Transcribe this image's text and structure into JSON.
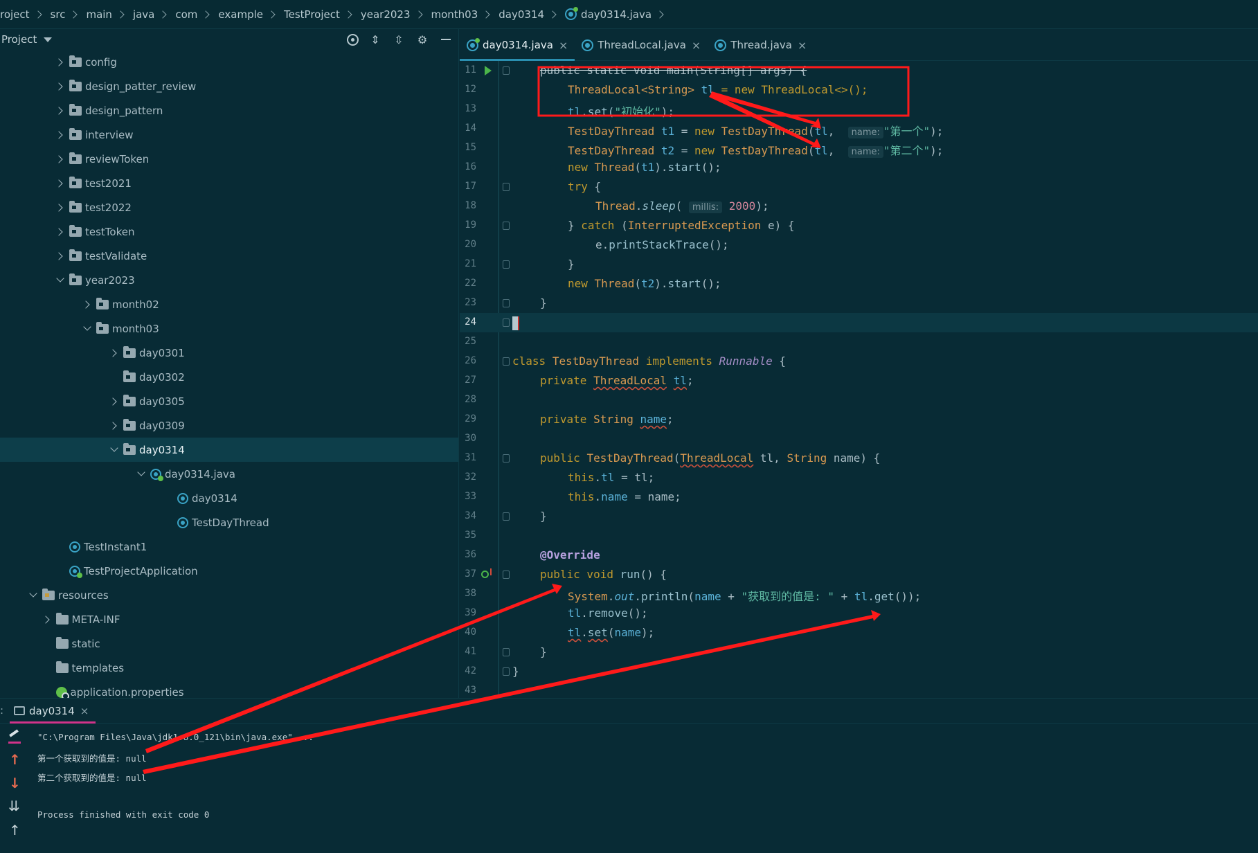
{
  "breadcrumb": [
    "roject",
    "src",
    "main",
    "java",
    "com",
    "example",
    "TestProject",
    "year2023",
    "month03",
    "day0314",
    "day0314.java"
  ],
  "project_panel": {
    "title": "Project",
    "tools": [
      "target-icon",
      "expand-all-icon",
      "collapse-all-icon",
      "gear-icon",
      "minimize-icon"
    ],
    "tree": [
      {
        "label": "config",
        "depth": 0,
        "state": "collapsed",
        "icon": "package-folder"
      },
      {
        "label": "design_patter_review",
        "depth": 0,
        "state": "collapsed",
        "icon": "package-folder"
      },
      {
        "label": "design_pattern",
        "depth": 0,
        "state": "collapsed",
        "icon": "package-folder"
      },
      {
        "label": "interview",
        "depth": 0,
        "state": "collapsed",
        "icon": "package-folder"
      },
      {
        "label": "reviewToken",
        "depth": 0,
        "state": "collapsed",
        "icon": "package-folder"
      },
      {
        "label": "test2021",
        "depth": 0,
        "state": "collapsed",
        "icon": "package-folder"
      },
      {
        "label": "test2022",
        "depth": 0,
        "state": "collapsed",
        "icon": "package-folder"
      },
      {
        "label": "testToken",
        "depth": 0,
        "state": "collapsed",
        "icon": "package-folder"
      },
      {
        "label": "testValidate",
        "depth": 0,
        "state": "collapsed",
        "icon": "package-folder"
      },
      {
        "label": "year2023",
        "depth": 0,
        "state": "expanded",
        "icon": "package-folder"
      },
      {
        "label": "month02",
        "depth": 1,
        "state": "collapsed",
        "icon": "package-folder"
      },
      {
        "label": "month03",
        "depth": 1,
        "state": "expanded",
        "icon": "package-folder"
      },
      {
        "label": "day0301",
        "depth": 2,
        "state": "collapsed",
        "icon": "package-folder"
      },
      {
        "label": "day0302",
        "depth": 2,
        "state": "leaf",
        "icon": "package-folder"
      },
      {
        "label": "day0305",
        "depth": 2,
        "state": "collapsed",
        "icon": "package-folder"
      },
      {
        "label": "day0309",
        "depth": 2,
        "state": "collapsed",
        "icon": "package-folder"
      },
      {
        "label": "day0314",
        "depth": 2,
        "state": "expanded",
        "icon": "package-folder",
        "selected": true
      },
      {
        "label": "day0314.java",
        "depth": 3,
        "state": "expanded",
        "icon": "java-file"
      },
      {
        "label": "day0314",
        "depth": 4,
        "state": "leaf",
        "icon": "java-class"
      },
      {
        "label": "TestDayThread",
        "depth": 4,
        "state": "leaf",
        "icon": "java-class"
      },
      {
        "label": "TestInstant1",
        "depth": 0,
        "state": "leaf",
        "icon": "java-class"
      },
      {
        "label": "TestProjectApplication",
        "depth": 0,
        "state": "leaf",
        "icon": "spring-app-class"
      },
      {
        "label": "resources",
        "depth": -1,
        "state": "expanded",
        "icon": "resources-folder"
      },
      {
        "label": "META-INF",
        "depth": -0.5,
        "state": "collapsed",
        "icon": "folder"
      },
      {
        "label": "static",
        "depth": -0.5,
        "state": "leaf",
        "icon": "folder"
      },
      {
        "label": "templates",
        "depth": -0.5,
        "state": "leaf",
        "icon": "folder"
      },
      {
        "label": "application.properties",
        "depth": -0.5,
        "state": "leaf",
        "icon": "properties-file"
      }
    ]
  },
  "editor": {
    "tabs": [
      {
        "label": "day0314.java",
        "active": true
      },
      {
        "label": "ThreadLocal.java",
        "active": false
      },
      {
        "label": "Thread.java",
        "active": false
      }
    ],
    "current_line": 24
  },
  "code_tokens": {
    "l11": "public static void main(String[] args) {",
    "l12_type": "ThreadLocal<String>",
    "l12_var": "tl",
    "l12_rest": "= new ThreadLocal<>();",
    "l13_var": "tl",
    "l13_call": ".set(",
    "l13_str": "\"初始化\"",
    "l13_end": ");",
    "hint_name": "name:",
    "hint_millis": "millis:",
    "l14_str": "\"第一个\"",
    "l15_str": "\"第二个\"",
    "l18_num": "2000",
    "l38_str": "\"获取到的值是: \"",
    "annotation": "@Override"
  },
  "console": {
    "tab_prefix": ":",
    "tab_label": "day0314",
    "lines": [
      "\"C:\\Program Files\\Java\\jdk1.8.0_121\\bin\\java.exe\" ...",
      "第一个获取到的值是: null",
      "第二个获取到的值是: null",
      "",
      "Process finished with exit code 0"
    ]
  },
  "colors": {
    "background": "#082b35",
    "annotation_red": "#ff1a1a",
    "console_tab_underline": "#d1338a"
  }
}
